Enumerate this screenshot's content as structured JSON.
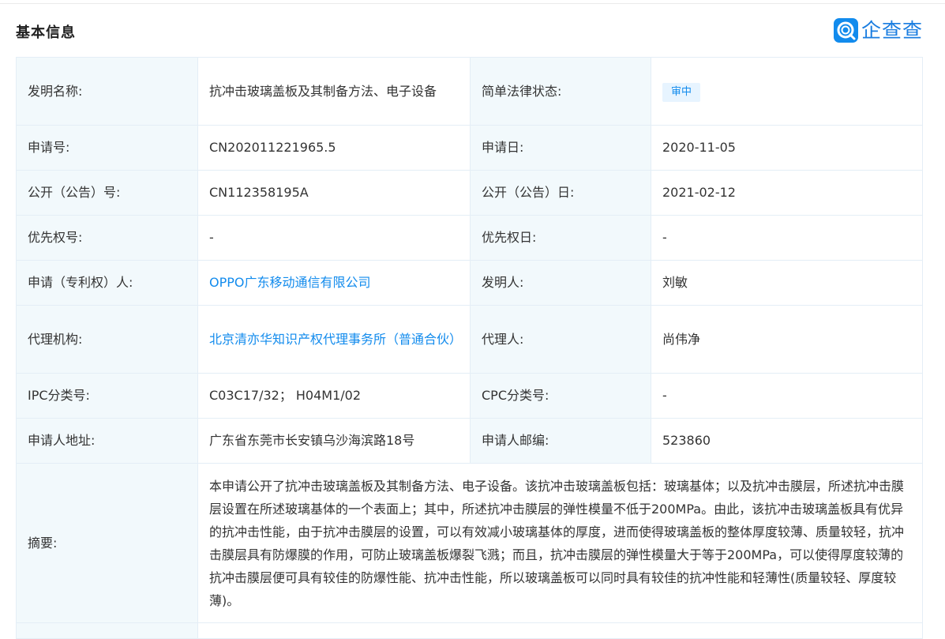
{
  "header": {
    "section_title": "基本信息",
    "brand_name": "企查查",
    "brand_color": "#128bed"
  },
  "rows": [
    {
      "label1": "发明名称:",
      "value1": "抗冲击玻璃盖板及其制备方法、电子设备",
      "label2": "简单法律状态:",
      "value2": "审中"
    },
    {
      "label1": "申请号:",
      "value1": "CN202011221965.5",
      "label2": "申请日:",
      "value2": "2020-11-05"
    },
    {
      "label1": "公开（公告）号:",
      "value1": "CN112358195A",
      "label2": "公开（公告）日:",
      "value2": "2021-02-12"
    },
    {
      "label1": "优先权号:",
      "value1": "-",
      "label2": "优先权日:",
      "value2": "-"
    },
    {
      "label1": "申请（专利权）人:",
      "value1": "OPPO广东移动通信有限公司",
      "label2": "发明人:",
      "value2": "刘敏"
    },
    {
      "label1": "代理机构:",
      "value1": "北京清亦华知识产权代理事务所（普通合伙）",
      "label2": "代理人:",
      "value2": "尚伟净"
    },
    {
      "label1": "IPC分类号:",
      "value1": "C03C17/32； H04M1/02",
      "label2": "CPC分类号:",
      "value2": "-"
    },
    {
      "label1": "申请人地址:",
      "value1": "广东省东莞市长安镇乌沙海滨路18号",
      "label2": "申请人邮编:",
      "value2": "523860"
    }
  ],
  "abstract": {
    "label": "摘要:",
    "text": "本申请公开了抗冲击玻璃盖板及其制备方法、电子设备。该抗冲击玻璃盖板包括：玻璃基体；以及抗冲击膜层，所述抗冲击膜层设置在所述玻璃基体的一个表面上；其中，所述抗冲击膜层的弹性模量不低于200MPa。由此，该抗冲击玻璃盖板具有优异的抗冲击性能，由于抗冲击膜层的设置，可以有效减小玻璃基体的厚度，进而使得玻璃盖板的整体厚度较薄、质量较轻，抗冲击膜层具有防爆膜的作用，可防止玻璃盖板爆裂飞溅；而且，抗冲击膜层的弹性模量大于等于200MPa，可以使得厚度较薄的抗冲击膜层便可具有较佳的防爆性能、抗冲击性能，所以玻璃盖板可以同时具有较佳的抗冲性能和轻薄性(质量较轻、厚度较薄)。"
  }
}
